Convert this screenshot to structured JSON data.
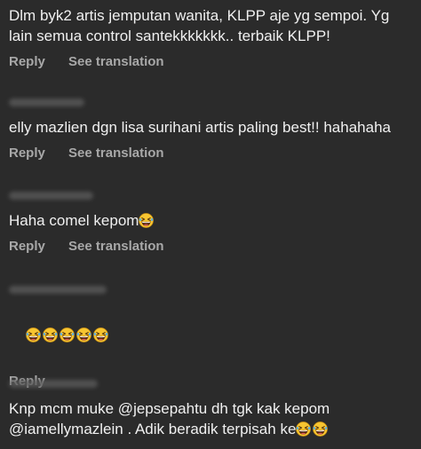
{
  "comments": [
    {
      "text": "Dlm byk2 artis jemputan wanita, KLPP aje yg sempoi. Yg lain semua control santekkkkkkk.. terbaik KLPP!",
      "reply_label": "Reply",
      "translate_label": "See translation"
    },
    {
      "text": "elly mazlien dgn lisa surihani artis paling best!! hahahaha",
      "reply_label": "Reply",
      "translate_label": "See translation"
    },
    {
      "text": "Haha comel kepom",
      "reply_label": "Reply",
      "translate_label": "See translation"
    },
    {
      "text": "",
      "reply_label": "Reply"
    },
    {
      "text_line1": "Knp mcm muke @jepsepahtu dh tgk kak kepom",
      "text_line2": "@iamellymazlein . Adik beradik terpisah ke"
    }
  ],
  "emoji": {
    "name": "grinning-squinting-laughing-face",
    "face_color": "#f7c531",
    "outline_color": "#c98f12"
  }
}
